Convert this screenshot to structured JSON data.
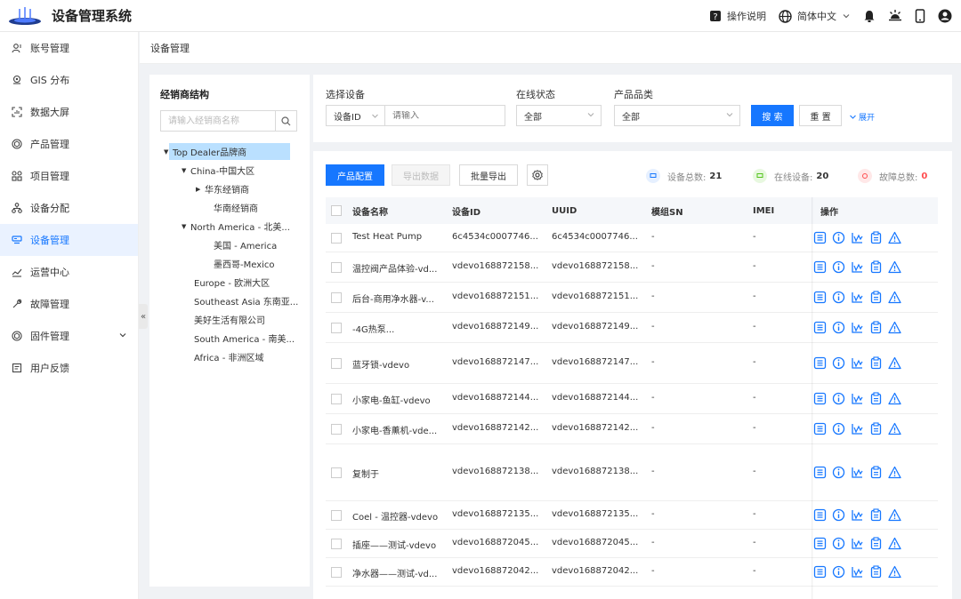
{
  "app": {
    "title": "设备管理系统"
  },
  "topbar": {
    "help_label": "操作说明",
    "lang_label": "简体中文"
  },
  "sidebar": {
    "items": [
      {
        "label": "账号管理",
        "icon": "user-icon"
      },
      {
        "label": "GIS 分布",
        "icon": "location-icon"
      },
      {
        "label": "数据大屏",
        "icon": "screen-icon"
      },
      {
        "label": "产品管理",
        "icon": "product-icon"
      },
      {
        "label": "项目管理",
        "icon": "grid-icon"
      },
      {
        "label": "设备分配",
        "icon": "share-icon"
      },
      {
        "label": "设备管理",
        "icon": "device-icon",
        "active": true
      },
      {
        "label": "运营中心",
        "icon": "chart-icon"
      },
      {
        "label": "故障管理",
        "icon": "wrench-icon"
      },
      {
        "label": "固件管理",
        "icon": "firmware-icon"
      },
      {
        "label": "用户反馈",
        "icon": "feedback-icon"
      }
    ],
    "collapse_label": "«"
  },
  "breadcrumb": {
    "label": "设备管理"
  },
  "tree": {
    "title": "经销商结构",
    "search_placeholder": "请输入经销商名称",
    "nodes": [
      {
        "label": "Top Dealer品牌商",
        "arrow": "▼",
        "selected": true
      },
      {
        "label": "China-中国大区",
        "arrow": "▼"
      },
      {
        "label": "华东经销商",
        "arrow": "▶"
      },
      {
        "label": "华南经销商",
        "arrow": ""
      },
      {
        "label": "North America - 北美...",
        "arrow": "▼"
      },
      {
        "label": "美国 - America",
        "arrow": ""
      },
      {
        "label": "墨西哥-Mexico",
        "arrow": ""
      },
      {
        "label": "Europe - 欧洲大区",
        "arrow": ""
      },
      {
        "label": "Southeast Asia 东南亚...",
        "arrow": ""
      },
      {
        "label": "美好生活有限公司",
        "arrow": ""
      },
      {
        "label": "South America - 南美...",
        "arrow": ""
      },
      {
        "label": "Africa - 非洲区域",
        "arrow": ""
      }
    ]
  },
  "filters": {
    "device_label": "选择设备",
    "device_type": "设备ID",
    "device_placeholder": "请输入",
    "status_label": "在线状态",
    "status_value": "全部",
    "category_label": "产品品类",
    "category_value": "全部",
    "search_btn": "搜 索",
    "reset_btn": "重 置",
    "expand_label": "展开"
  },
  "toolbar": {
    "config_btn": "产品配置",
    "export_btn": "导出数据",
    "batch_export_btn": "批量导出"
  },
  "stats": {
    "total_label": "设备总数:",
    "total_value": "21",
    "online_label": "在线设备:",
    "online_value": "20",
    "fault_label": "故障总数:",
    "fault_value": "0",
    "colors": {
      "total": "#1677ff",
      "online": "#52c41a",
      "fault": "#ff4d4f"
    }
  },
  "table": {
    "headers": [
      "设备名称",
      "设备ID",
      "UUID",
      "模组SN",
      "IMEI",
      "操作"
    ],
    "rows": [
      {
        "name": "Test Heat Pump",
        "id": "6c4534c0007746...",
        "uuid": "6c4534c0007746...",
        "sn": "-",
        "imei": "-"
      },
      {
        "name": "温控阀产品体验-vd...",
        "id": "vdevo168872158...",
        "uuid": "vdevo168872158...",
        "sn": "-",
        "imei": "-"
      },
      {
        "name": "后台-商用净水器-v...",
        "id": "vdevo168872151...",
        "uuid": "vdevo168872151...",
        "sn": "-",
        "imei": "-"
      },
      {
        "name": "-4G热泵...",
        "id": "vdevo168872149...",
        "uuid": "vdevo168872149...",
        "sn": "-",
        "imei": "-"
      },
      {
        "name": "蓝牙锁-vdevo",
        "id": "vdevo168872147...",
        "uuid": "vdevo168872147...",
        "sn": "-",
        "imei": "-"
      },
      {
        "name": "小家电-鱼缸-vdevo",
        "id": "vdevo168872144...",
        "uuid": "vdevo168872144...",
        "sn": "-",
        "imei": "-"
      },
      {
        "name": "小家电-香薰机-vde...",
        "id": "vdevo168872142...",
        "uuid": "vdevo168872142...",
        "sn": "-",
        "imei": "-"
      },
      {
        "name": "复制于",
        "id": "vdevo168872138...",
        "uuid": "vdevo168872138...",
        "sn": "-",
        "imei": "-"
      },
      {
        "name": "Coel - 温控器-vdevo",
        "id": "vdevo168872135...",
        "uuid": "vdevo168872135...",
        "sn": "-",
        "imei": "-"
      },
      {
        "name": "插座——测试-vdevo",
        "id": "vdevo168872045...",
        "uuid": "vdevo168872045...",
        "sn": "-",
        "imei": "-"
      },
      {
        "name": "净水器——测试-vd...",
        "id": "vdevo168872042...",
        "uuid": "vdevo168872042...",
        "sn": "-",
        "imei": "-"
      }
    ],
    "op_icons": [
      "list-icon",
      "info-icon",
      "trend-icon",
      "clipboard-icon",
      "warning-icon"
    ]
  }
}
